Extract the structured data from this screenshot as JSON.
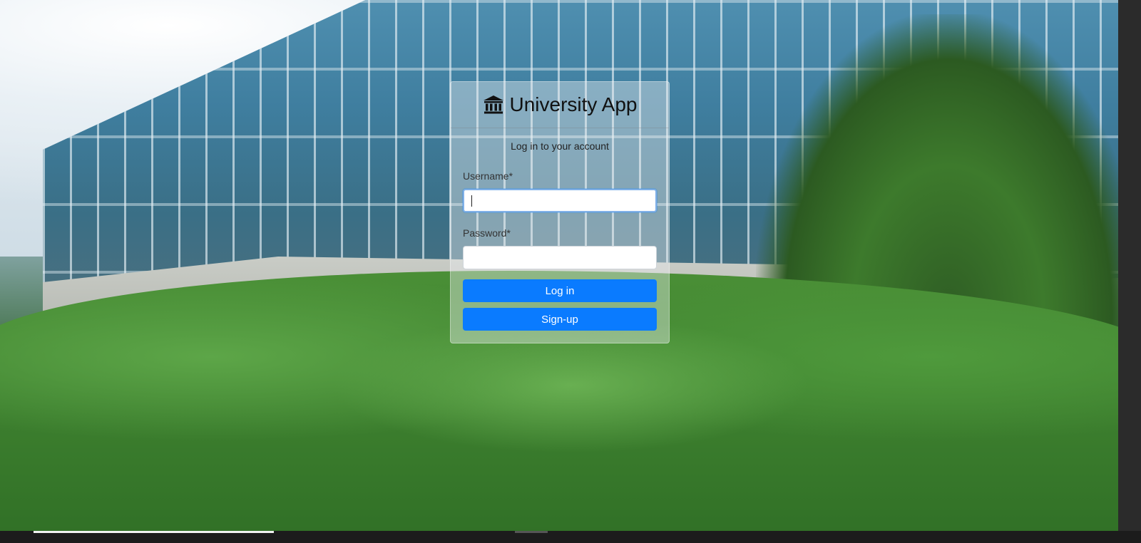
{
  "app": {
    "title": "University App",
    "icon": "university-icon"
  },
  "login": {
    "subtitle": "Log in to your account",
    "username_label": "Username*",
    "username_value": "",
    "password_label": "Password*",
    "password_value": "",
    "login_button": "Log in",
    "signup_button": "Sign-up"
  },
  "colors": {
    "primary_button": "#0a7bff",
    "focus_ring": "#7fb0e8"
  }
}
